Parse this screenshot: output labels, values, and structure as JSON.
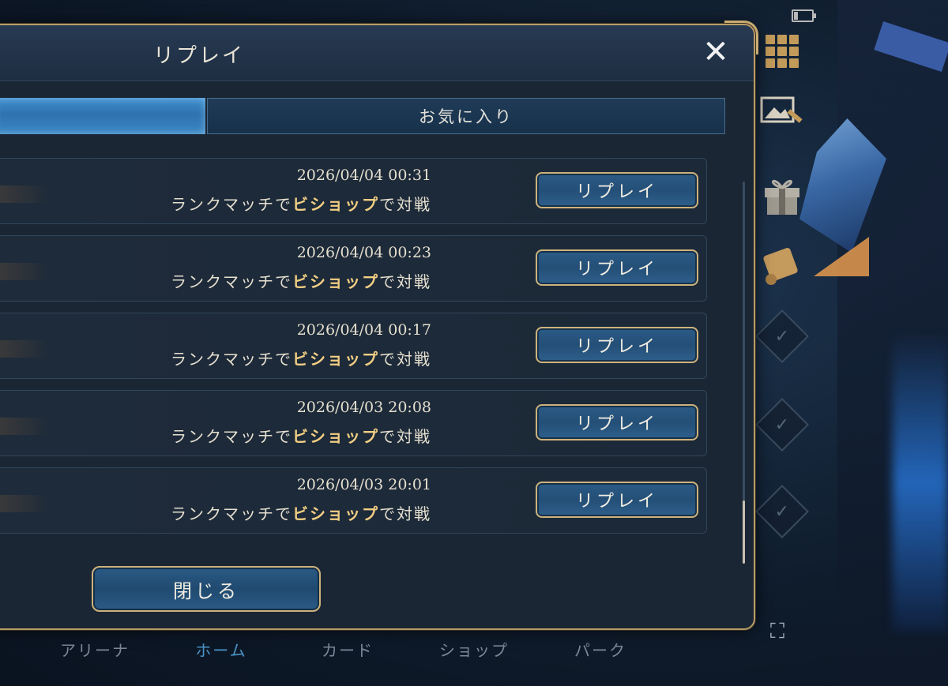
{
  "dialog": {
    "title": "リプレイ",
    "close_icon": "close-icon",
    "tabs": [
      {
        "label": "",
        "active": true
      },
      {
        "label": "お気に入り",
        "active": false
      }
    ],
    "rows": [
      {
        "date": "2026/04/04 00:31",
        "desc_prefix": "ランクマッチで",
        "desc_class": "ビショップ",
        "desc_suffix": "で対戦",
        "button": "リプレイ"
      },
      {
        "date": "2026/04/04 00:23",
        "desc_prefix": "ランクマッチで",
        "desc_class": "ビショップ",
        "desc_suffix": "で対戦",
        "button": "リプレイ"
      },
      {
        "date": "2026/04/04 00:17",
        "desc_prefix": "ランクマッチで",
        "desc_class": "ビショップ",
        "desc_suffix": "で対戦",
        "button": "リプレイ"
      },
      {
        "date": "2026/04/03 20:08",
        "desc_prefix": "ランクマッチで",
        "desc_class": "ビショップ",
        "desc_suffix": "で対戦",
        "button": "リプレイ"
      },
      {
        "date": "2026/04/03 20:01",
        "desc_prefix": "ランクマッチで",
        "desc_class": "ビショップ",
        "desc_suffix": "で対戦",
        "button": "リプレイ"
      }
    ],
    "close_button": "閉じる"
  },
  "bottom_nav": [
    {
      "label": "アリーナ"
    },
    {
      "label": "ホーム"
    },
    {
      "label": "カード"
    },
    {
      "label": "ショップ"
    },
    {
      "label": "パーク"
    }
  ],
  "side_icons": [
    "battery-icon",
    "menu-grid-icon",
    "photo-edit-icon",
    "gift-box-icon",
    "scroll-icon",
    "mission-check-icon",
    "mission-check-icon",
    "mission-check-icon",
    "fullscreen-icon"
  ],
  "colors": {
    "accent_gold": "#cdb27c",
    "tab_active": "#3f8fce",
    "class_highlight": "#f2ce83",
    "panel": "#1a2634"
  }
}
